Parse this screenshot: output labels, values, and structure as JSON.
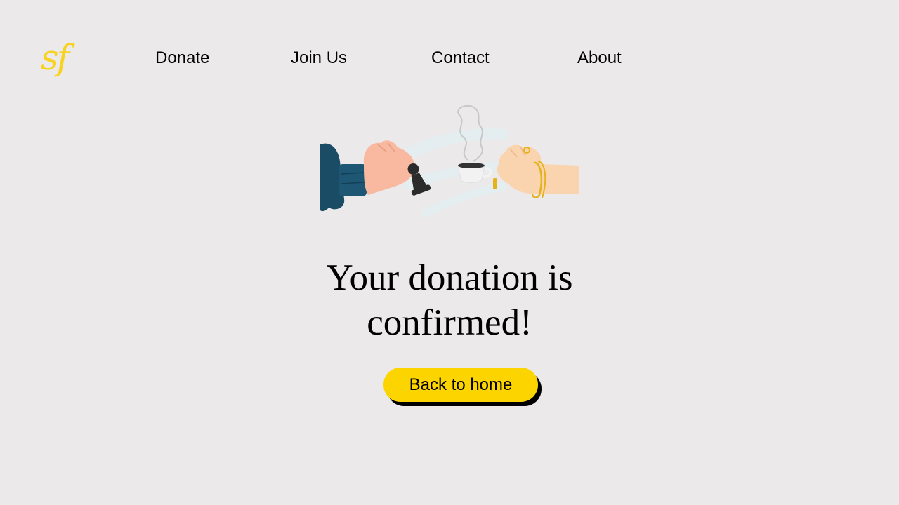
{
  "logo": {
    "text": "sf",
    "color": "#F8D21C"
  },
  "nav": {
    "items": [
      {
        "label": "Donate"
      },
      {
        "label": "Join Us"
      },
      {
        "label": "Contact"
      },
      {
        "label": "About"
      }
    ]
  },
  "illustration": {
    "icon": "hands-exchanging-chess-pawn-and-coffee-illustration"
  },
  "confirmation": {
    "heading_line1": "Your donation is",
    "heading_line2": "confirmed!"
  },
  "button": {
    "label": "Back to home",
    "color": "#FCD500"
  },
  "colors": {
    "background": "#EBE9EA",
    "accent": "#FCD500",
    "sleeve": "#1B4C66"
  }
}
